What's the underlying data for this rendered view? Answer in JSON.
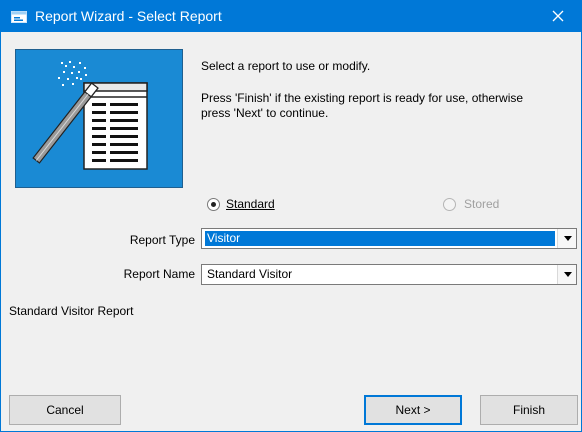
{
  "window": {
    "title": "Report Wizard - Select Report"
  },
  "intro": {
    "line1": "Select a report to use or modify.",
    "line2": "Press 'Finish' if the existing report is ready for use, otherwise",
    "line3": "press 'Next' to continue."
  },
  "source_options": {
    "standard_label": "Standard",
    "standard_checked": true,
    "stored_label": "Stored",
    "stored_checked": false,
    "stored_enabled": false
  },
  "report_type": {
    "label": "Report Type",
    "value": "Visitor"
  },
  "report_name": {
    "label": "Report Name",
    "value": "Standard Visitor"
  },
  "description": "Standard Visitor Report",
  "buttons": {
    "cancel": "Cancel",
    "next": "Next >",
    "finish": "Finish"
  },
  "icons": {
    "title": "window-app-icon",
    "close": "close-icon",
    "wizard": "report-wizard-wand-icon",
    "dropdown": "chevron-down-icon"
  },
  "colors": {
    "titlebar": "#0078d7",
    "wizard_image": "#1a8ad4",
    "selection": "#0078d7"
  }
}
